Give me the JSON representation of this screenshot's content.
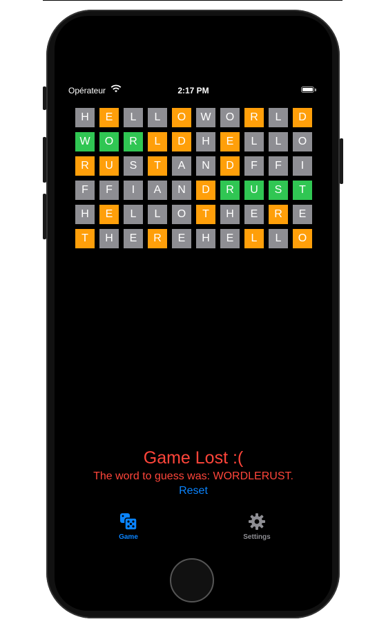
{
  "status_bar": {
    "carrier": "Opérateur",
    "time": "2:17 PM"
  },
  "board": {
    "rows": [
      [
        [
          "H",
          "absent"
        ],
        [
          "E",
          "present"
        ],
        [
          "L",
          "absent"
        ],
        [
          "L",
          "absent"
        ],
        [
          "O",
          "present"
        ],
        [
          "W",
          "absent"
        ],
        [
          "O",
          "absent"
        ],
        [
          "R",
          "present"
        ],
        [
          "L",
          "absent"
        ],
        [
          "D",
          "present"
        ]
      ],
      [
        [
          "W",
          "correct"
        ],
        [
          "O",
          "correct"
        ],
        [
          "R",
          "correct"
        ],
        [
          "L",
          "present"
        ],
        [
          "D",
          "present"
        ],
        [
          "H",
          "absent"
        ],
        [
          "E",
          "present"
        ],
        [
          "L",
          "absent"
        ],
        [
          "L",
          "absent"
        ],
        [
          "O",
          "absent"
        ]
      ],
      [
        [
          "R",
          "present"
        ],
        [
          "U",
          "present"
        ],
        [
          "S",
          "absent"
        ],
        [
          "T",
          "present"
        ],
        [
          "A",
          "absent"
        ],
        [
          "N",
          "absent"
        ],
        [
          "D",
          "present"
        ],
        [
          "F",
          "absent"
        ],
        [
          "F",
          "absent"
        ],
        [
          "I",
          "absent"
        ]
      ],
      [
        [
          "F",
          "absent"
        ],
        [
          "F",
          "absent"
        ],
        [
          "I",
          "absent"
        ],
        [
          "A",
          "absent"
        ],
        [
          "N",
          "absent"
        ],
        [
          "D",
          "present"
        ],
        [
          "R",
          "correct"
        ],
        [
          "U",
          "correct"
        ],
        [
          "S",
          "correct"
        ],
        [
          "T",
          "correct"
        ]
      ],
      [
        [
          "H",
          "absent"
        ],
        [
          "E",
          "present"
        ],
        [
          "L",
          "absent"
        ],
        [
          "L",
          "absent"
        ],
        [
          "O",
          "absent"
        ],
        [
          "T",
          "present"
        ],
        [
          "H",
          "absent"
        ],
        [
          "E",
          "absent"
        ],
        [
          "R",
          "present"
        ],
        [
          "E",
          "absent"
        ]
      ],
      [
        [
          "T",
          "present"
        ],
        [
          "H",
          "absent"
        ],
        [
          "E",
          "absent"
        ],
        [
          "R",
          "present"
        ],
        [
          "E",
          "absent"
        ],
        [
          "H",
          "absent"
        ],
        [
          "E",
          "absent"
        ],
        [
          "L",
          "present"
        ],
        [
          "L",
          "absent"
        ],
        [
          "O",
          "present"
        ]
      ]
    ]
  },
  "result": {
    "title": "Game Lost :(",
    "message": "The word to guess was: WORDLERUST.",
    "reset_label": "Reset"
  },
  "tabs": {
    "game": {
      "label": "Game",
      "icon": "dice-icon",
      "active": true
    },
    "settings": {
      "label": "Settings",
      "icon": "gear-icon",
      "active": false
    }
  },
  "colors": {
    "correct": "#30c653",
    "present": "#ff9f0a",
    "absent": "#8e8e93",
    "accent": "#0a84ff",
    "error": "#ff453a"
  }
}
